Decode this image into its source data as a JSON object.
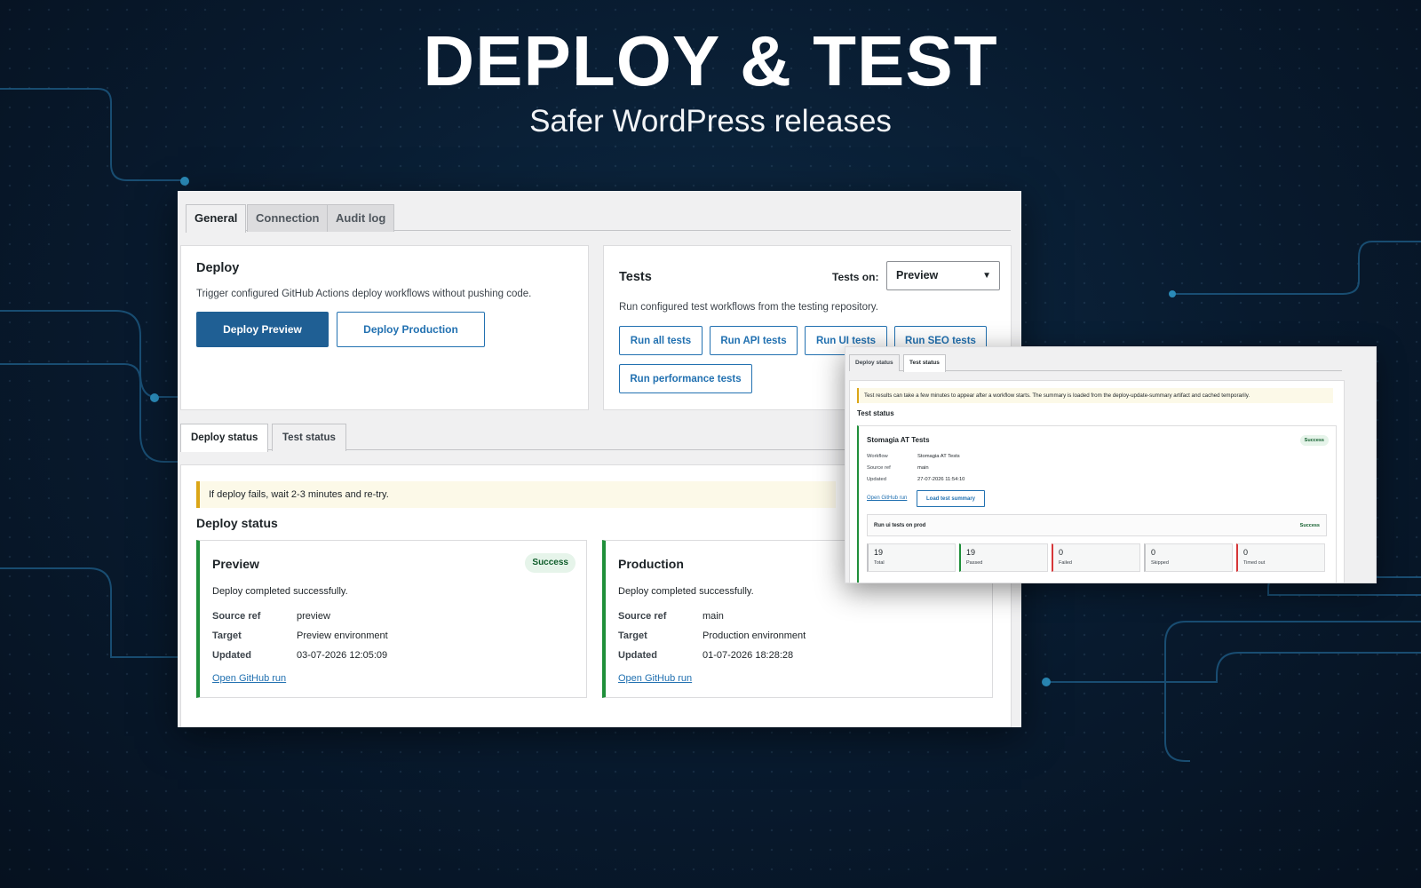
{
  "hero": {
    "title": "DEPLOY & TEST",
    "subtitle": "Safer WordPress releases"
  },
  "main_tabs": [
    {
      "label": "General",
      "active": true
    },
    {
      "label": "Connection",
      "active": false
    },
    {
      "label": "Audit log",
      "active": false
    }
  ],
  "deploy_card": {
    "title": "Deploy",
    "description": "Trigger configured GitHub Actions deploy workflows without pushing code.",
    "preview_button": "Deploy Preview",
    "production_button": "Deploy Production"
  },
  "tests_card": {
    "title": "Tests",
    "tests_on_label": "Tests on:",
    "tests_on_value": "Preview",
    "description": "Run configured test workflows from the testing repository.",
    "buttons": [
      "Run all tests",
      "Run API tests",
      "Run UI tests",
      "Run SEO tests",
      "Run performance tests"
    ]
  },
  "status_tabs": [
    {
      "label": "Deploy status",
      "active": true
    },
    {
      "label": "Test status",
      "active": false
    }
  ],
  "deploy_status": {
    "notice": "If deploy fails, wait 2-3 minutes and re-try.",
    "title": "Deploy status",
    "source_ref_label": "Source ref",
    "target_label": "Target",
    "updated_label": "Updated",
    "link_label": "Open GitHub run",
    "preview": {
      "name": "Preview",
      "badge": "Success",
      "message": "Deploy completed successfully.",
      "source_ref": "preview",
      "target": "Preview environment",
      "updated": "03-07-2026 12:05:09"
    },
    "production": {
      "name": "Production",
      "message": "Deploy completed successfully.",
      "source_ref": "main",
      "target": "Production environment",
      "updated": "01-07-2026 18:28:28"
    }
  },
  "test_status_panel": {
    "tabs": [
      {
        "label": "Deploy status",
        "active": false
      },
      {
        "label": "Test status",
        "active": true
      }
    ],
    "notice": "Test results can take a few minutes to appear after a workflow starts. The summary is loaded from the deploy-update-summary artifact and cached temporarily.",
    "title": "Test status",
    "card": {
      "name": "Stomagia AT Tests",
      "badge": "Success",
      "workflow_label": "Workflow",
      "workflow": "Stomagia AT Tests",
      "source_ref_label": "Source ref",
      "source_ref": "main",
      "updated_label": "Updated",
      "updated": "27-07-2026 11:54:10",
      "link_label": "Open GitHub run",
      "summary_button": "Load test summary",
      "subrun": {
        "label": "Run ui tests on prod",
        "badge": "Success"
      },
      "stats": [
        {
          "value": "19",
          "label": "Total",
          "color": "#c3c4c7"
        },
        {
          "value": "19",
          "label": "Passed",
          "color": "#1f8f3a"
        },
        {
          "value": "0",
          "label": "Failed",
          "color": "#d63638"
        },
        {
          "value": "0",
          "label": "Skipped",
          "color": "#c3c4c7"
        },
        {
          "value": "0",
          "label": "Timed out",
          "color": "#d63638"
        }
      ]
    }
  },
  "colors": {
    "accent": "#2271b1",
    "primary_button": "#1f5f94",
    "success": "#1f8f3a",
    "warning": "#dba617",
    "background": "#081a2e"
  }
}
